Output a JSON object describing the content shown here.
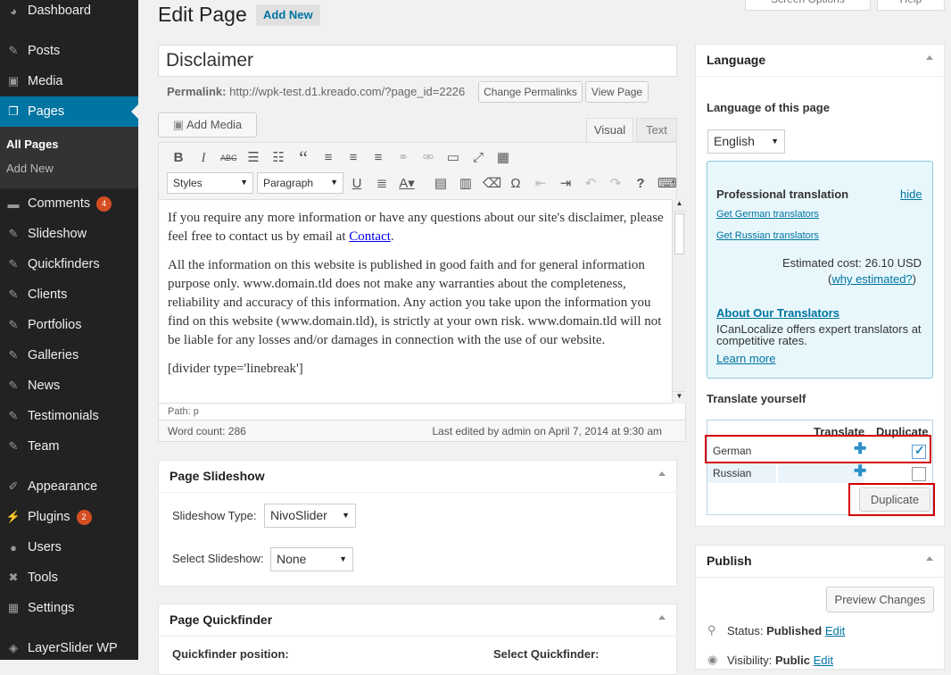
{
  "sidebar": {
    "items": [
      {
        "label": "Dashboard",
        "icon": "dashboard-icon",
        "badge": ""
      },
      {
        "label": "Posts",
        "icon": "pin-icon",
        "badge": ""
      },
      {
        "label": "Media",
        "icon": "media-icon",
        "badge": ""
      },
      {
        "label": "Pages",
        "icon": "pages-icon",
        "badge": ""
      },
      {
        "label": "Comments",
        "icon": "comment-icon",
        "badge": "4"
      },
      {
        "label": "Slideshow",
        "icon": "pin-icon",
        "badge": ""
      },
      {
        "label": "Quickfinders",
        "icon": "pin-icon",
        "badge": ""
      },
      {
        "label": "Clients",
        "icon": "pin-icon",
        "badge": ""
      },
      {
        "label": "Portfolios",
        "icon": "pin-icon",
        "badge": ""
      },
      {
        "label": "Galleries",
        "icon": "pin-icon",
        "badge": ""
      },
      {
        "label": "News",
        "icon": "pin-icon",
        "badge": ""
      },
      {
        "label": "Testimonials",
        "icon": "pin-icon",
        "badge": ""
      },
      {
        "label": "Team",
        "icon": "pin-icon",
        "badge": ""
      },
      {
        "label": "Appearance",
        "icon": "brush-icon",
        "badge": ""
      },
      {
        "label": "Plugins",
        "icon": "plugin-icon",
        "badge": "2"
      },
      {
        "label": "Users",
        "icon": "user-icon",
        "badge": ""
      },
      {
        "label": "Tools",
        "icon": "wrench-icon",
        "badge": ""
      },
      {
        "label": "Settings",
        "icon": "settings-icon",
        "badge": ""
      },
      {
        "label": "LayerSlider WP",
        "icon": "layers-icon",
        "badge": ""
      }
    ],
    "pages_sub": {
      "all_pages": "All Pages",
      "add_new": "Add New"
    }
  },
  "header": {
    "title": "Edit Page",
    "add_new": "Add New",
    "screen_options": "Screen Options",
    "help": "Help"
  },
  "post": {
    "title": "Disclaimer",
    "permalink_label": "Permalink:",
    "permalink_url": "http://wpk-test.d1.kreado.com/?page_id=2226",
    "change_permalinks": "Change Permalinks",
    "view_page": "View Page",
    "add_media": "Add Media",
    "tab_visual": "Visual",
    "tab_text": "Text",
    "styles": "Styles",
    "paragraph": "Paragraph",
    "content_p1a": "If you require any more information or have any questions about our site's disclaimer, please feel free to contact us by email at ",
    "content_p1_link": "Contact",
    "content_p1b": ".",
    "content_p2": "All the information on this website is published in good faith and for general information purpose only. www.domain.tld does not make any warranties about the completeness, reliability and accuracy of this information. Any action you take upon the information you find on this website (www.domain.tld), is strictly at your own risk. www.domain.tld will not be liable for any losses and/or damages in connection with the use of our website.",
    "content_p3": "[divider type='linebreak']",
    "path": "Path: p",
    "word_count": "Word count: 286",
    "last_edited": "Last edited by admin on April 7, 2014 at 9:30 am"
  },
  "slideshow_box": {
    "title": "Page Slideshow",
    "type_label": "Slideshow Type:",
    "type_value": "NivoSlider",
    "select_label": "Select Slideshow:",
    "select_value": "None"
  },
  "quickfinder_box": {
    "title": "Page Quickfinder",
    "position_label": "Quickfinder position:",
    "select_label": "Select Quickfinder:"
  },
  "language_box": {
    "title": "Language",
    "lang_label": "Language of this page",
    "lang_value": "English",
    "pro_title": "Professional translation",
    "hide": "hide",
    "german_translators": "Get German translators",
    "russian_translators": "Get Russian translators",
    "estimated_cost": "Estimated cost: 26.10 USD",
    "why_estimated": "why estimated?",
    "about_translators": "About Our Translators",
    "about_text": "ICanLocalize offers expert translators at competitive rates.",
    "learn_more": "Learn more",
    "translate_yourself": "Translate yourself",
    "col_translate": "Translate",
    "col_duplicate": "Duplicate",
    "rows": [
      {
        "lang": "German",
        "duplicate": true
      },
      {
        "lang": "Russian",
        "duplicate": false
      }
    ],
    "duplicate_button": "Duplicate"
  },
  "publish_box": {
    "title": "Publish",
    "preview": "Preview Changes",
    "status_label": "Status:",
    "status_value": "Published",
    "edit": "Edit",
    "visibility_label": "Visibility:",
    "visibility_value": "Public",
    "edit2": "Edit"
  },
  "colors": {
    "accent": "#0074a2",
    "sidebar": "#222222",
    "highlight": "#d40000"
  }
}
